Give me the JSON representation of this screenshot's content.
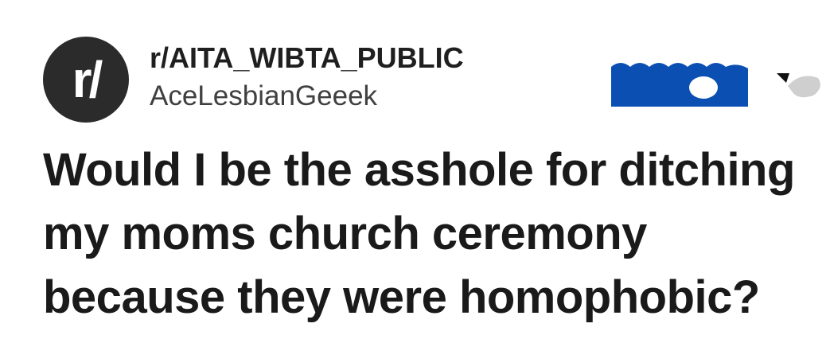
{
  "post": {
    "subreddit": "r/AITA_WIBTA_PUBLIC",
    "avatar_text": "r/",
    "username": "AceLesbianGeeek",
    "title": "Would I be the asshole for ditching my moms church ceremony because they were homophobic?"
  },
  "colors": {
    "avatar_bg": "#2b2b2b",
    "join_button": "#0b4fb3",
    "text_primary": "#1a1a1b",
    "text_secondary": "#404040"
  },
  "icons": {
    "join": "join-button-shape",
    "overflow": "overflow-icon"
  }
}
